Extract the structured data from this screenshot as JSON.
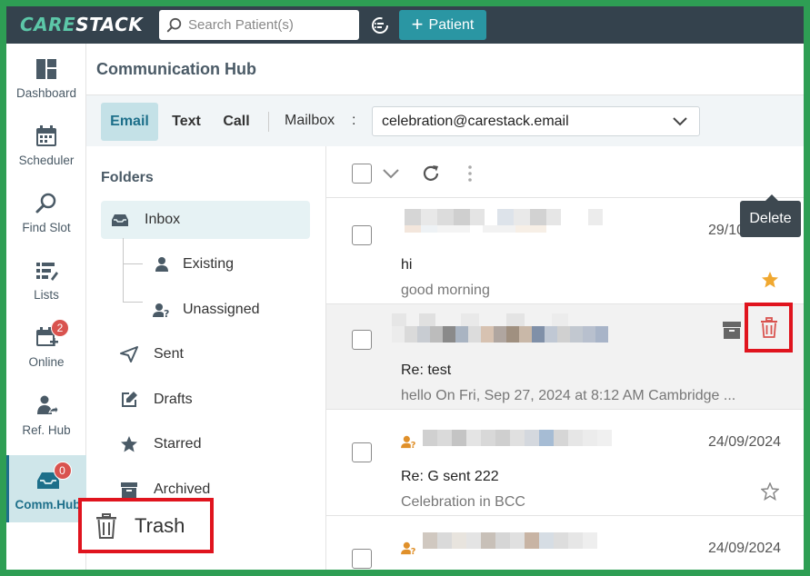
{
  "brand": {
    "logo_part1": "CARE",
    "logo_part2": "STACK"
  },
  "search": {
    "placeholder": "Search Patient(s)"
  },
  "add_patient": {
    "label": "Patient"
  },
  "nav": [
    {
      "label": "Dashboard",
      "icon": "dashboard-icon"
    },
    {
      "label": "Scheduler",
      "icon": "calendar-icon"
    },
    {
      "label": "Find Slot",
      "icon": "search-icon"
    },
    {
      "label": "Lists",
      "icon": "list-icon"
    },
    {
      "label": "Online",
      "icon": "calendar-plus-icon",
      "badge": "2"
    },
    {
      "label": "Ref. Hub",
      "icon": "person-share-icon"
    },
    {
      "label": "Comm.Hub",
      "icon": "inbox-icon",
      "badge": "0"
    }
  ],
  "page_title": "Communication Hub",
  "tabs": {
    "email": "Email",
    "text": "Text",
    "call": "Call"
  },
  "mailbox": {
    "label": "Mailbox",
    "colon": ":",
    "value": "celebration@carestack.email"
  },
  "folders": {
    "title": "Folders",
    "inbox": "Inbox",
    "existing": "Existing",
    "unassigned": "Unassigned",
    "sent": "Sent",
    "drafts": "Drafts",
    "starred": "Starred",
    "archived": "Archived",
    "trash": "Trash"
  },
  "emails": [
    {
      "date": "29/10/2024",
      "subject": "hi",
      "preview": "good morning",
      "starred": true
    },
    {
      "date": "",
      "subject": "Re: test",
      "preview": "hello On Fri, Sep 27, 2024 at 8:12 AM Cambridge ...",
      "starred": false
    },
    {
      "date": "24/09/2024",
      "subject": "Re: G sent 222",
      "preview": "Celebration in BCC",
      "starred": false
    },
    {
      "date": "24/09/2024",
      "subject": "",
      "preview": "",
      "starred": false
    }
  ],
  "tooltip": {
    "delete": "Delete"
  },
  "colors": {
    "accent": "#2a96a3",
    "topbar": "#34424d",
    "highlight": "#e0141e",
    "star": "#f0a830"
  }
}
